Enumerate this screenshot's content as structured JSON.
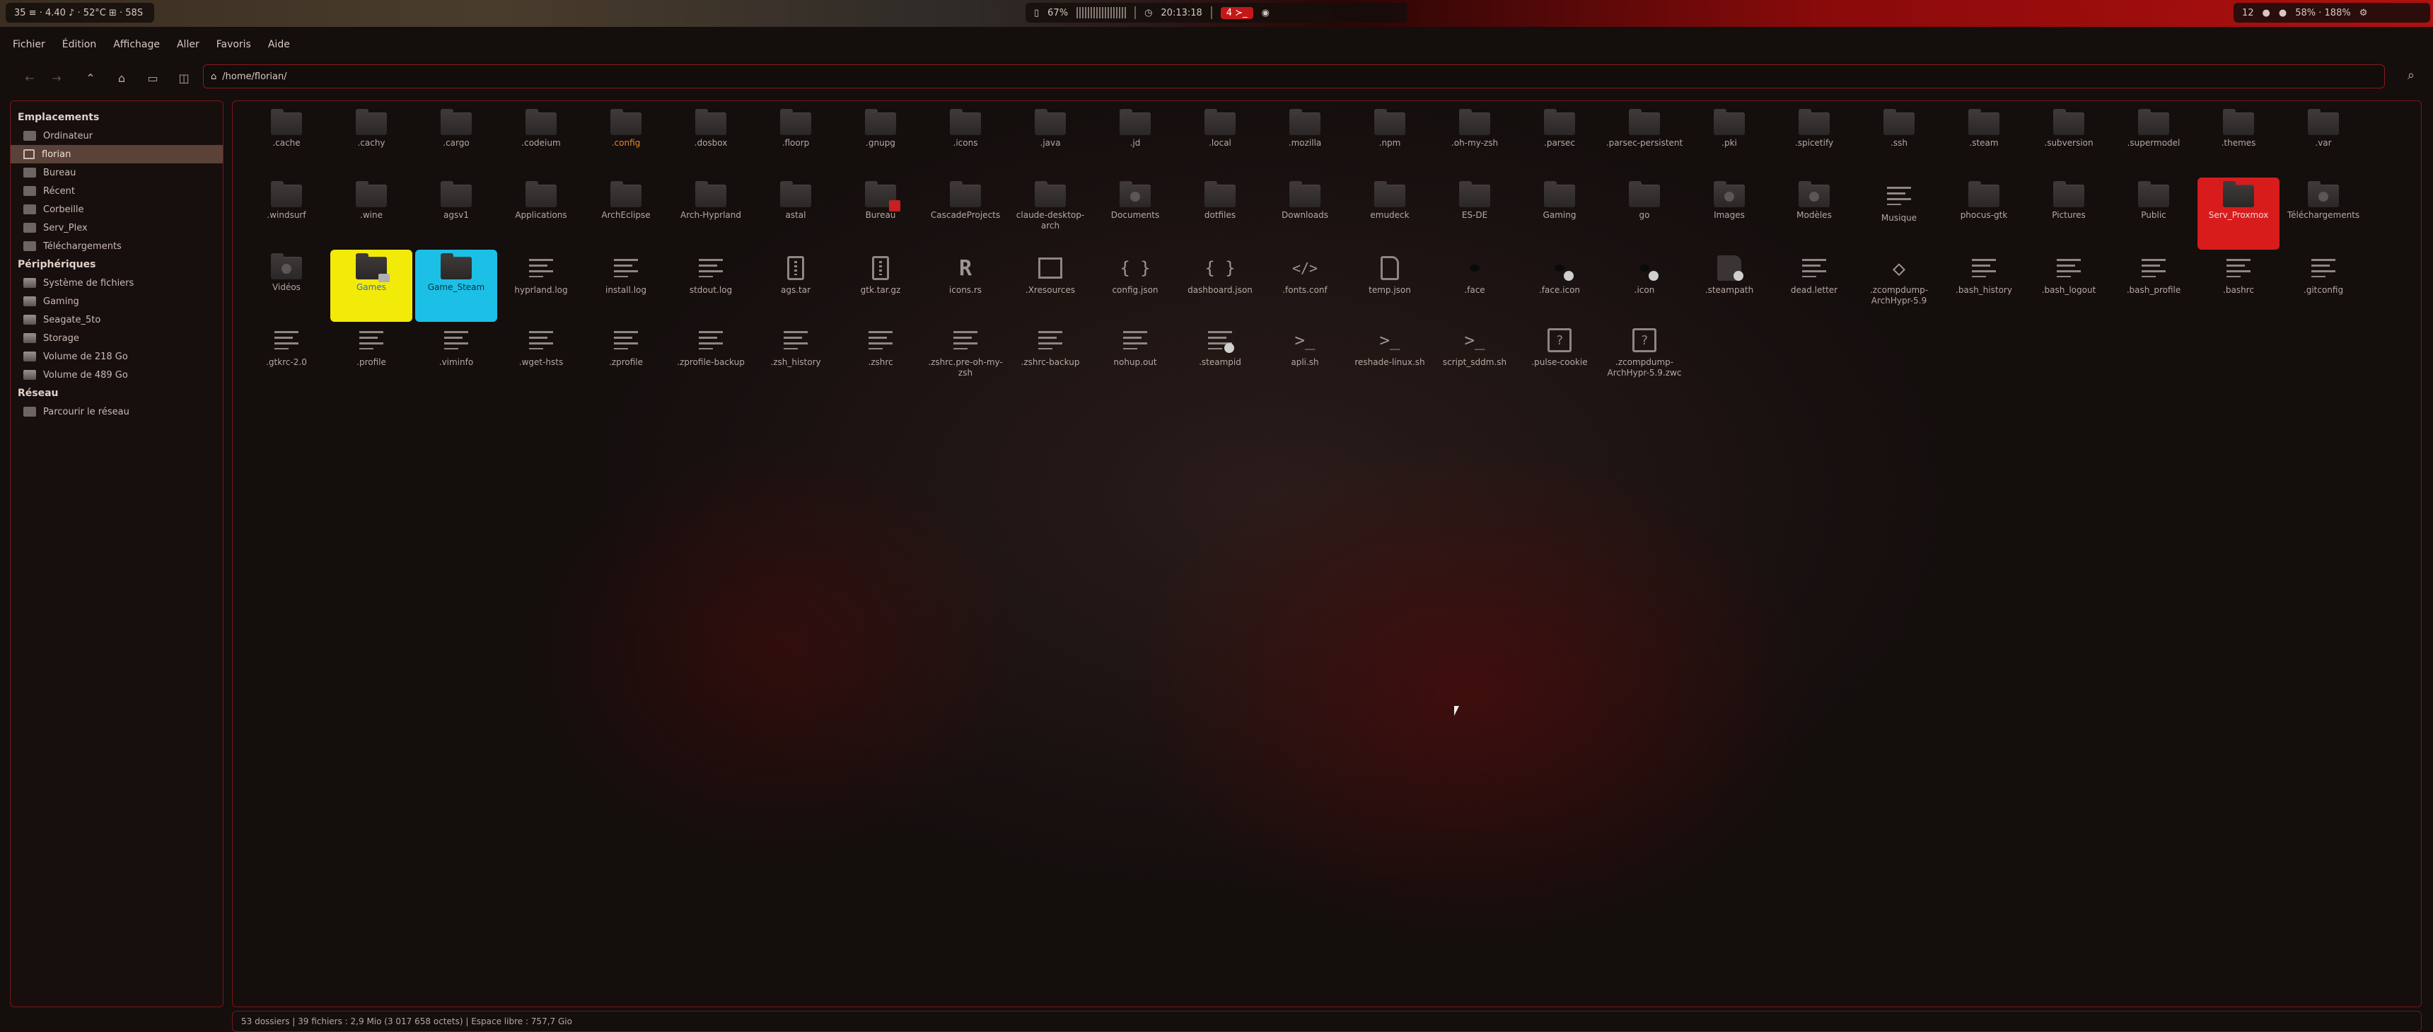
{
  "topbar": {
    "left_text": "35 ≡ · 4.40 ♪ · 52°C ⊞ · 58S",
    "center_left": "67%",
    "clock": "20:13:18",
    "workspace_tag": "4 ≻_",
    "right_text": "12",
    "right_stats": "58% · 188%"
  },
  "menubar": [
    "Fichier",
    "Édition",
    "Affichage",
    "Aller",
    "Favoris",
    "Aide"
  ],
  "toolbar": {
    "path": "/home/florian/"
  },
  "sidebar": {
    "sections": [
      {
        "title": "Emplacements",
        "items": [
          {
            "label": "Ordinateur",
            "icon": "computer-icon"
          },
          {
            "label": "florian",
            "icon": "home-icon",
            "active": true
          },
          {
            "label": "Bureau",
            "icon": "folder-icon"
          },
          {
            "label": "Récent",
            "icon": "recent-icon"
          },
          {
            "label": "Corbeille",
            "icon": "trash-icon"
          },
          {
            "label": "Serv_Plex",
            "icon": "folder-icon"
          },
          {
            "label": "Téléchargements",
            "icon": "folder-icon"
          }
        ]
      },
      {
        "title": "Périphériques",
        "items": [
          {
            "label": "Système de fichiers",
            "icon": "drive-icon"
          },
          {
            "label": "Gaming",
            "icon": "drive-icon"
          },
          {
            "label": "Seagate_5to",
            "icon": "drive-icon"
          },
          {
            "label": "Storage",
            "icon": "drive-icon"
          },
          {
            "label": "Volume de 218 Go",
            "icon": "drive-icon"
          },
          {
            "label": "Volume de 489 Go",
            "icon": "drive-icon"
          }
        ]
      },
      {
        "title": "Réseau",
        "items": [
          {
            "label": "Parcourir le réseau",
            "icon": "network-icon"
          }
        ]
      }
    ]
  },
  "files": [
    {
      "name": ".cache",
      "kind": "folder"
    },
    {
      "name": ".cachy",
      "kind": "folder"
    },
    {
      "name": ".cargo",
      "kind": "folder"
    },
    {
      "name": ".codeium",
      "kind": "folder"
    },
    {
      "name": ".config",
      "kind": "folder",
      "style": "orange"
    },
    {
      "name": ".dosbox",
      "kind": "folder"
    },
    {
      "name": ".floorp",
      "kind": "folder"
    },
    {
      "name": ".gnupg",
      "kind": "folder"
    },
    {
      "name": ".icons",
      "kind": "folder"
    },
    {
      "name": ".java",
      "kind": "folder"
    },
    {
      "name": ".jd",
      "kind": "folder"
    },
    {
      "name": ".local",
      "kind": "folder"
    },
    {
      "name": ".mozilla",
      "kind": "folder"
    },
    {
      "name": ".npm",
      "kind": "folder"
    },
    {
      "name": ".oh-my-zsh",
      "kind": "folder"
    },
    {
      "name": ".parsec",
      "kind": "folder"
    },
    {
      "name": ".parsec-persistent",
      "kind": "folder"
    },
    {
      "name": ".pki",
      "kind": "folder"
    },
    {
      "name": ".spicetify",
      "kind": "folder"
    },
    {
      "name": ".ssh",
      "kind": "folder"
    },
    {
      "name": ".steam",
      "kind": "folder"
    },
    {
      "name": ".subversion",
      "kind": "folder"
    },
    {
      "name": ".supermodel",
      "kind": "folder"
    },
    {
      "name": ".themes",
      "kind": "folder"
    },
    {
      "name": ".var",
      "kind": "folder"
    },
    {
      "name": "",
      "kind": "gap"
    },
    {
      "name": "",
      "kind": "gap"
    },
    {
      "name": ".windsurf",
      "kind": "folder"
    },
    {
      "name": ".wine",
      "kind": "folder"
    },
    {
      "name": "agsv1",
      "kind": "folder"
    },
    {
      "name": "Applications",
      "kind": "folder"
    },
    {
      "name": "ArchEclipse",
      "kind": "folder"
    },
    {
      "name": "Arch-Hyprland",
      "kind": "folder"
    },
    {
      "name": "astal",
      "kind": "folder"
    },
    {
      "name": "Bureau",
      "kind": "folder-badge"
    },
    {
      "name": "CascadeProjects",
      "kind": "folder"
    },
    {
      "name": "claude-desktop-arch",
      "kind": "folder"
    },
    {
      "name": "Documents",
      "kind": "folder-emblem"
    },
    {
      "name": "dotfiles",
      "kind": "folder"
    },
    {
      "name": "Downloads",
      "kind": "folder"
    },
    {
      "name": "emudeck",
      "kind": "folder"
    },
    {
      "name": "ES-DE",
      "kind": "folder"
    },
    {
      "name": "Gaming",
      "kind": "folder"
    },
    {
      "name": "go",
      "kind": "folder"
    },
    {
      "name": "Images",
      "kind": "folder-emblem"
    },
    {
      "name": "Modèles",
      "kind": "folder-emblem"
    },
    {
      "name": "Musique",
      "kind": "text"
    },
    {
      "name": "phocus-gtk",
      "kind": "folder"
    },
    {
      "name": "Pictures",
      "kind": "folder"
    },
    {
      "name": "Public",
      "kind": "folder"
    },
    {
      "name": "Serv_Proxmox",
      "kind": "folder",
      "style": "red"
    },
    {
      "name": "Téléchargements",
      "kind": "folder-emblem"
    },
    {
      "name": "",
      "kind": "gap"
    },
    {
      "name": "",
      "kind": "gap"
    },
    {
      "name": "Vidéos",
      "kind": "folder-emblem"
    },
    {
      "name": "Games",
      "kind": "folder-drive",
      "style": "yellow"
    },
    {
      "name": "Game_Steam",
      "kind": "folder",
      "style": "cyan"
    },
    {
      "name": "hyprland.log",
      "kind": "text"
    },
    {
      "name": "install.log",
      "kind": "text"
    },
    {
      "name": "stdout.log",
      "kind": "text"
    },
    {
      "name": "ags.tar",
      "kind": "zip"
    },
    {
      "name": "gtk.tar.gz",
      "kind": "zip"
    },
    {
      "name": "icons.rs",
      "kind": "rust"
    },
    {
      "name": ".Xresources",
      "kind": "image"
    },
    {
      "name": "config.json",
      "kind": "json"
    },
    {
      "name": "dashboard.json",
      "kind": "json"
    },
    {
      "name": ".fonts.conf",
      "kind": "code"
    },
    {
      "name": "temp.json",
      "kind": "doc"
    },
    {
      "name": ".face",
      "kind": "face"
    },
    {
      "name": ".face.icon",
      "kind": "face-link"
    },
    {
      "name": ".icon",
      "kind": "face-link"
    },
    {
      "name": ".steampath",
      "kind": "black-link"
    },
    {
      "name": "dead.letter",
      "kind": "text"
    },
    {
      "name": ".zcompdump-ArchHypr-5.9",
      "kind": "diamond"
    },
    {
      "name": ".bash_history",
      "kind": "text"
    },
    {
      "name": ".bash_logout",
      "kind": "text"
    },
    {
      "name": ".bash_profile",
      "kind": "text"
    },
    {
      "name": ".bashrc",
      "kind": "text"
    },
    {
      "name": ".gitconfig",
      "kind": "text"
    },
    {
      "name": "",
      "kind": "gap"
    },
    {
      "name": "",
      "kind": "gap"
    },
    {
      "name": ".gtkrc-2.0",
      "kind": "text"
    },
    {
      "name": ".profile",
      "kind": "text"
    },
    {
      "name": ".viminfo",
      "kind": "text"
    },
    {
      "name": ".wget-hsts",
      "kind": "text"
    },
    {
      "name": ".zprofile",
      "kind": "text"
    },
    {
      "name": ".zprofile-backup",
      "kind": "text"
    },
    {
      "name": ".zsh_history",
      "kind": "text"
    },
    {
      "name": ".zshrc",
      "kind": "text"
    },
    {
      "name": ".zshrc.pre-oh-my-zsh",
      "kind": "text"
    },
    {
      "name": ".zshrc-backup",
      "kind": "text"
    },
    {
      "name": "nohup.out",
      "kind": "text"
    },
    {
      "name": ".steampid",
      "kind": "text-link"
    },
    {
      "name": "apli.sh",
      "kind": "script"
    },
    {
      "name": "reshade-linux.sh",
      "kind": "script"
    },
    {
      "name": "script_sddm.sh",
      "kind": "script"
    },
    {
      "name": ".pulse-cookie",
      "kind": "unknown"
    },
    {
      "name": ".zcompdump-ArchHypr-5.9.zwc",
      "kind": "unknown"
    }
  ],
  "statusbar": {
    "text": "53 dossiers  |  39 fichiers : 2,9 Mio (3 017 658 octets)  |  Espace libre : 757,7 Gio"
  },
  "colors": {
    "accent_red": "#d81c1c",
    "highlight_yellow": "#f2ea08",
    "highlight_cyan": "#1cc0e6",
    "config_orange": "#e58b2c"
  }
}
